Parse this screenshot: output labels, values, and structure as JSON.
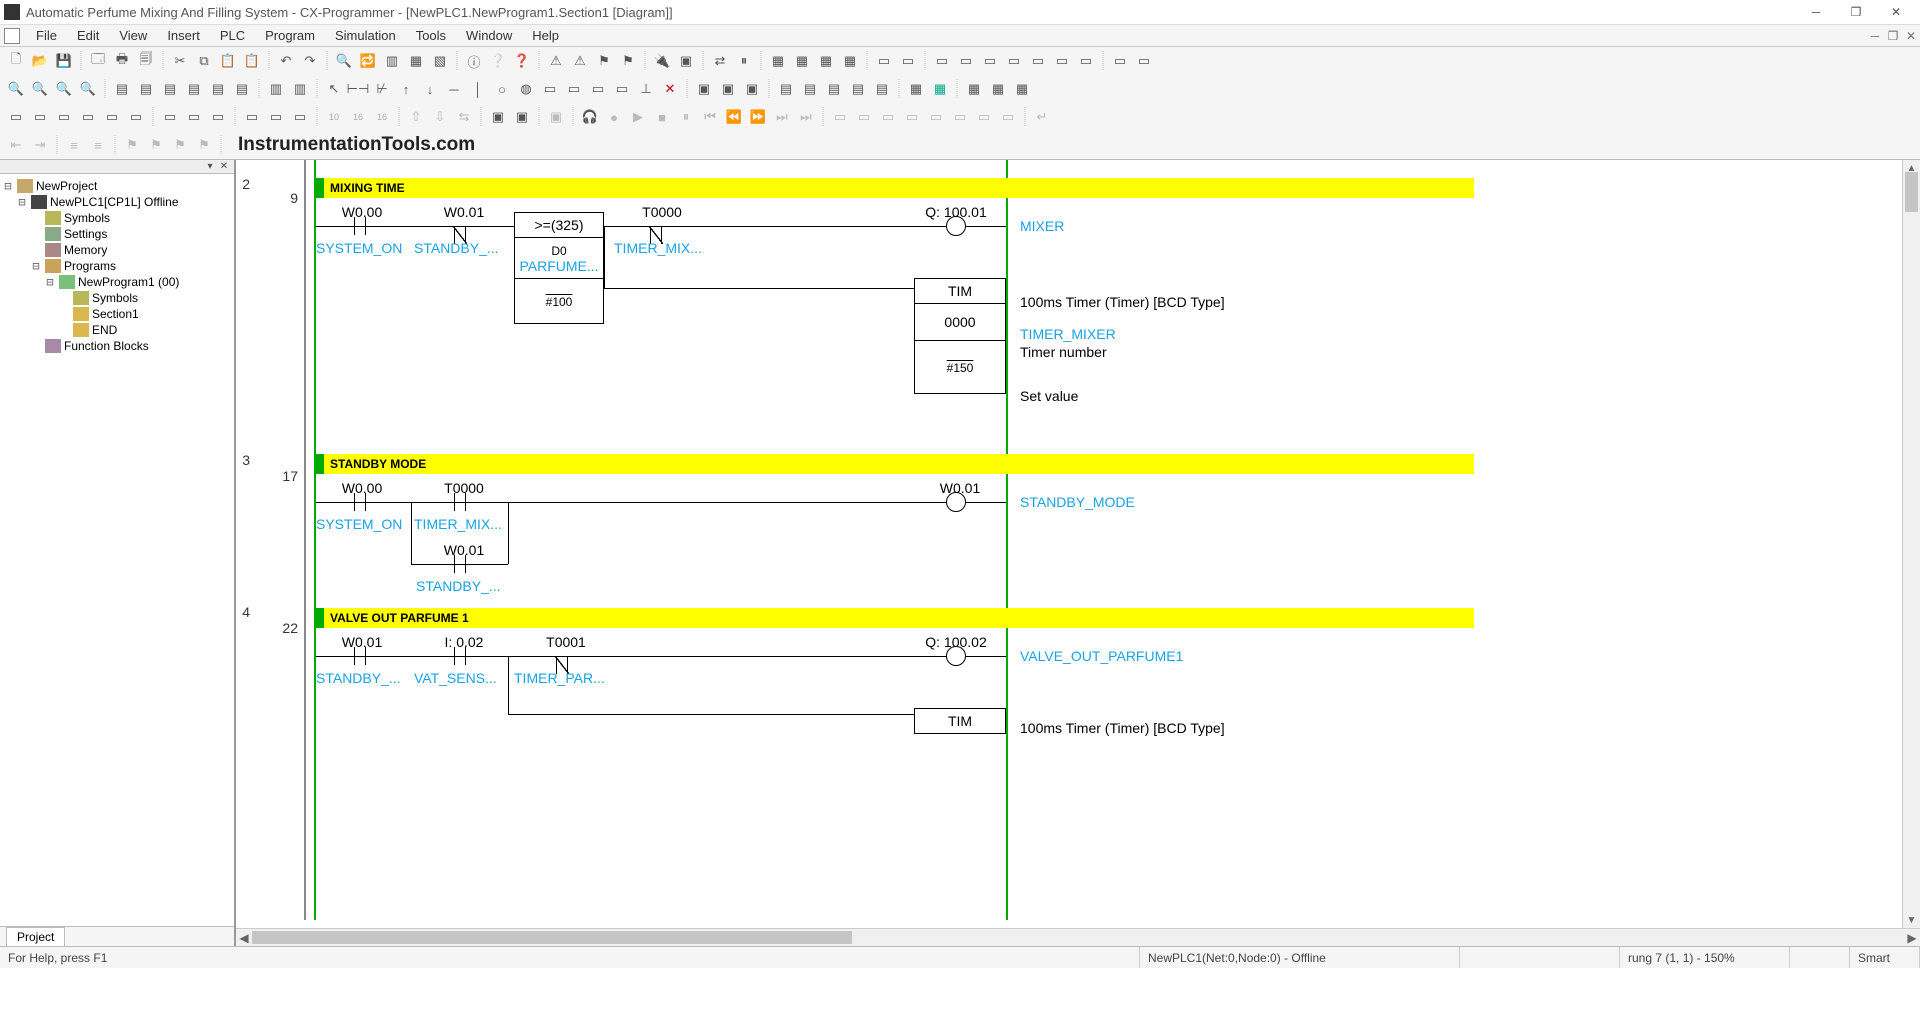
{
  "title": "Automatic Perfume Mixing And Filling System - CX-Programmer - [NewPLC1.NewProgram1.Section1 [Diagram]]",
  "menu": [
    "File",
    "Edit",
    "View",
    "Insert",
    "PLC",
    "Program",
    "Simulation",
    "Tools",
    "Window",
    "Help"
  ],
  "watermark": "InstrumentationTools.com",
  "tree": {
    "project": "NewProject",
    "plc": "NewPLC1[CP1L] Offline",
    "symbols": "Symbols",
    "settings": "Settings",
    "memory": "Memory",
    "programs": "Programs",
    "newprogram": "NewProgram1 (00)",
    "prog_symbols": "Symbols",
    "section1": "Section1",
    "end": "END",
    "fb": "Function Blocks"
  },
  "side_tab": "Project",
  "rungs": {
    "r2": {
      "num": "2",
      "step": "9",
      "title": "MIXING TIME",
      "c1_addr": "W0.00",
      "c1_sym": "SYSTEM_ON",
      "c2_addr": "W0.01",
      "c2_sym": "STANDBY_...",
      "c3_addr": "T0000",
      "c3_sym": "TIMER_MIX...",
      "cmp_op": ">=(325)",
      "cmp_v1": "D0",
      "cmp_v1s": "PARFUME...",
      "cmp_v2": "#100",
      "out_addr": "Q: 100.01",
      "out_sym": "MIXER",
      "tim_label": "TIM",
      "tim_num": "0000",
      "tim_sv": "#150",
      "tim_desc": "100ms Timer (Timer) [BCD Type]",
      "tim_name": "TIMER_MIXER",
      "tim_sub": "Timer number",
      "sv_label": "Set value"
    },
    "r3": {
      "num": "3",
      "step": "17",
      "title": "STANDBY MODE",
      "c1_addr": "W0.00",
      "c1_sym": "SYSTEM_ON",
      "c2_addr": "T0000",
      "c2_sym": "TIMER_MIX...",
      "c3_addr": "W0.01",
      "c3_sym": "STANDBY_...",
      "out_addr": "W0.01",
      "out_sym": "STANDBY_MODE"
    },
    "r4": {
      "num": "4",
      "step": "22",
      "title": "VALVE OUT PARFUME 1",
      "c1_addr": "W0.01",
      "c1_sym": "STANDBY_...",
      "c2_addr": "I: 0.02",
      "c2_sym": "VAT_SENS...",
      "c3_addr": "T0001",
      "c3_sym": "TIMER_PAR...",
      "out_addr": "Q: 100.02",
      "out_sym": "VALVE_OUT_PARFUME1",
      "tim_label": "TIM",
      "tim_desc": "100ms Timer (Timer) [BCD Type]"
    }
  },
  "status": {
    "help": "For Help, press F1",
    "plc": "NewPLC1(Net:0,Node:0) - Offline",
    "rung": "rung 7 (1, 1)  - 150%",
    "mode": "Smart"
  }
}
